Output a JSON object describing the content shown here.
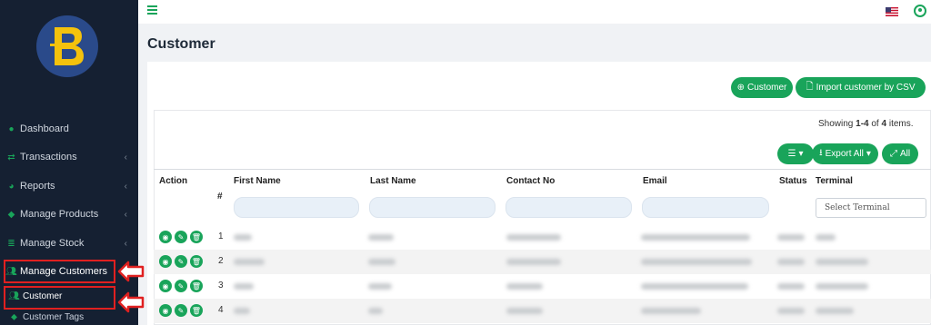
{
  "sidebar": {
    "items": [
      {
        "label": "Dashboard",
        "icon": "dashboard-icon",
        "has_chevron": false
      },
      {
        "label": "Transactions",
        "icon": "exchange-icon",
        "has_chevron": true
      },
      {
        "label": "Reports",
        "icon": "pie-chart-icon",
        "has_chevron": true
      },
      {
        "label": "Manage Products",
        "icon": "box-icon",
        "has_chevron": true
      },
      {
        "label": "Manage Stock",
        "icon": "list-icon",
        "has_chevron": true
      },
      {
        "label": "Manage Customers",
        "icon": "users-icon",
        "has_chevron": false
      },
      {
        "label": "Customer",
        "icon": "users-icon",
        "has_chevron": false
      },
      {
        "label": "Customer Tags",
        "icon": "tag-icon",
        "has_chevron": false
      }
    ]
  },
  "annotations": [
    "1",
    "2"
  ],
  "page": {
    "title": "Customer"
  },
  "toolbar": {
    "add_customer": "Customer",
    "import_csv": "Import customer by CSV",
    "export_all": "Export All",
    "all": "All"
  },
  "summary": {
    "prefix": "Showing ",
    "range": "1-4",
    "mid": " of ",
    "total": "4",
    "suffix": " items."
  },
  "table": {
    "columns": {
      "action": "Action",
      "index": "#",
      "first_name": "First Name",
      "last_name": "Last Name",
      "contact": "Contact No",
      "email": "Email",
      "status": "Status",
      "terminal": "Terminal"
    },
    "terminal_placeholder": "Select Terminal",
    "rows": [
      {
        "num": "1"
      },
      {
        "num": "2"
      },
      {
        "num": "3"
      },
      {
        "num": "4"
      }
    ]
  },
  "colors": {
    "accent": "#19a45a",
    "sidebar": "#152032",
    "annotation": "#e02020"
  }
}
